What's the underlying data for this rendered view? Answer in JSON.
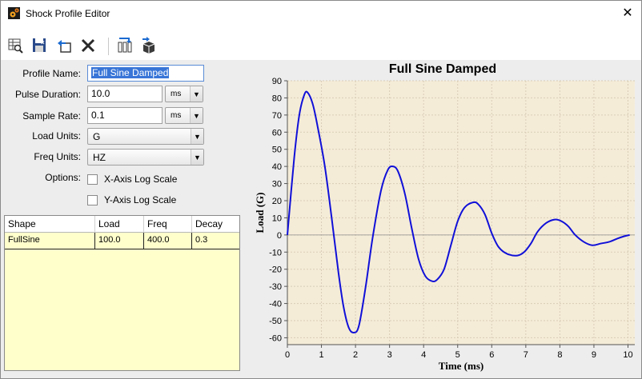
{
  "window": {
    "title": "Shock Profile Editor",
    "close_glyph": "✕"
  },
  "toolbar": {
    "items": [
      {
        "name": "table-view-icon"
      },
      {
        "name": "save-icon"
      },
      {
        "name": "undo-icon"
      },
      {
        "name": "delete-icon"
      },
      {
        "name": "import-icon"
      },
      {
        "name": "export-icon"
      }
    ]
  },
  "form": {
    "profile_name_label": "Profile Name:",
    "profile_name_value": "Full Sine Damped",
    "pulse_duration_label": "Pulse Duration:",
    "pulse_duration_value": "10.0",
    "pulse_duration_unit": "ms",
    "sample_rate_label": "Sample Rate:",
    "sample_rate_value": "0.1",
    "sample_rate_unit": "ms",
    "load_units_label": "Load Units:",
    "load_units_value": "G",
    "freq_units_label": "Freq Units:",
    "freq_units_value": "HZ",
    "options_label": "Options:",
    "x_log_label": "X-Axis Log Scale",
    "y_log_label": "Y-Axis Log Scale",
    "x_log_checked": false,
    "y_log_checked": false,
    "arrow_glyph": "▼"
  },
  "table": {
    "headers": [
      "Shape",
      "Load",
      "Freq",
      "Decay"
    ],
    "rows": [
      [
        "FullSine",
        "100.0",
        "400.0",
        "0.3"
      ]
    ]
  },
  "chart_data": {
    "type": "line",
    "title": "Full Sine Damped",
    "xlabel": "Time (ms)",
    "ylabel": "Load (G)",
    "xlim": [
      0,
      10.2
    ],
    "ylim": [
      -64,
      90
    ],
    "xticks": [
      0,
      1,
      2,
      3,
      4,
      5,
      6,
      7,
      8,
      9,
      10
    ],
    "yticks": [
      90,
      80,
      70,
      60,
      50,
      40,
      30,
      20,
      10,
      0,
      -10,
      -20,
      -30,
      -40,
      -50,
      -60
    ],
    "grid": true,
    "series": [
      {
        "color": "#1010d8",
        "x": [
          0,
          0.2,
          0.35,
          0.5,
          0.6,
          0.75,
          0.9,
          1.1,
          1.3,
          1.5,
          1.65,
          1.8,
          1.95,
          2.1,
          2.3,
          2.5,
          2.75,
          2.95,
          3.1,
          3.25,
          3.45,
          3.65,
          3.85,
          4.05,
          4.25,
          4.4,
          4.6,
          4.8,
          5.0,
          5.2,
          5.45,
          5.6,
          5.8,
          6.0,
          6.2,
          6.45,
          6.75,
          6.95,
          7.15,
          7.35,
          7.6,
          7.85,
          8.05,
          8.25,
          8.45,
          8.7,
          8.95,
          9.2,
          9.45,
          9.7,
          9.85,
          10.05
        ],
        "y": [
          0,
          45,
          70,
          82,
          83,
          76,
          62,
          40,
          10,
          -22,
          -42,
          -54,
          -57,
          -53,
          -30,
          -2,
          26,
          38,
          40,
          37,
          24,
          4,
          -14,
          -24,
          -27,
          -26,
          -20,
          -6,
          8,
          16,
          19,
          18,
          12,
          1,
          -7,
          -11,
          -12,
          -10,
          -5,
          2,
          7,
          9,
          8,
          5,
          0,
          -4,
          -6,
          -5,
          -4,
          -2,
          -1,
          0
        ]
      }
    ]
  }
}
